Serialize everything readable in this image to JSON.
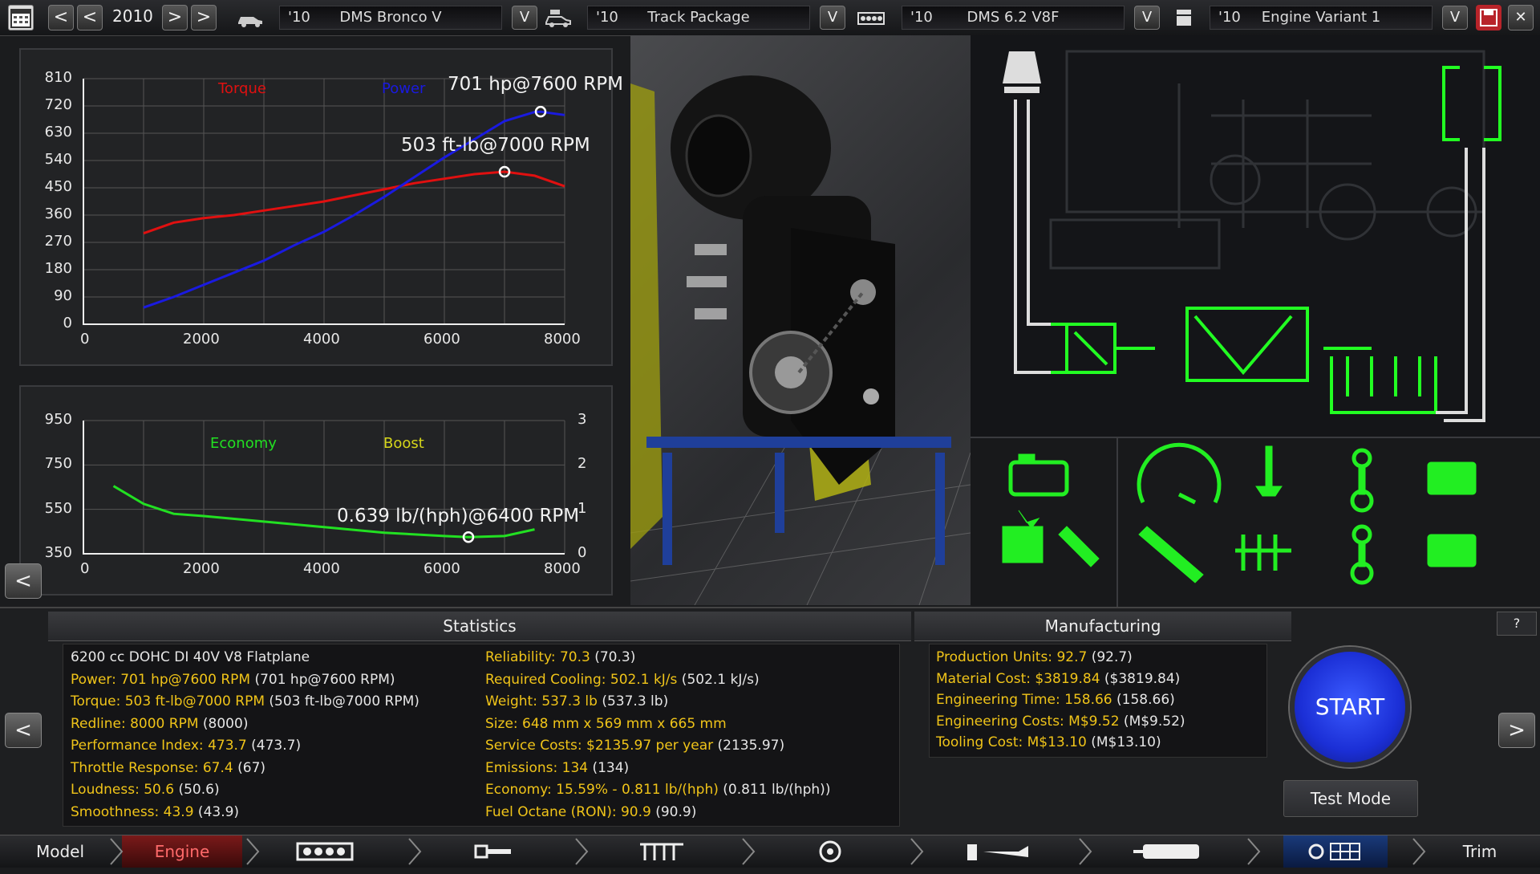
{
  "topbar": {
    "year": "2010",
    "model": {
      "year": "'10",
      "name": "DMS Bronco V"
    },
    "trim": {
      "year": "'10",
      "name": "Track Package"
    },
    "engine_family": {
      "year": "'10",
      "name": "DMS 6.2 V8F"
    },
    "engine_variant": {
      "year": "'10",
      "name": "Engine Variant 1"
    },
    "prev_label": "<",
    "next_label": ">",
    "dropdown_label": "V",
    "close_label": "✕"
  },
  "power_chart": {
    "legend_torque": "Torque",
    "legend_power": "Power",
    "power_peak_label": "701 hp@7600 RPM",
    "torque_peak_label": "503 ft-lb@7000 RPM",
    "y_ticks": [
      "810",
      "720",
      "630",
      "540",
      "450",
      "360",
      "270",
      "180",
      "90",
      "0"
    ],
    "x_ticks": [
      "0",
      "2000",
      "4000",
      "6000",
      "8000"
    ]
  },
  "economy_chart": {
    "legend_economy": "Economy",
    "legend_boost": "Boost",
    "economy_peak_label": "0.639 lb/(hph)@6400 RPM",
    "y_ticks": [
      "950",
      "750",
      "550",
      "350"
    ],
    "y2_ticks": [
      "3",
      "2",
      "1",
      "0"
    ],
    "x_ticks": [
      "0",
      "2000",
      "4000",
      "6000",
      "8000"
    ]
  },
  "chart_data": [
    {
      "type": "line",
      "xlim": [
        0,
        8000
      ],
      "ylim": [
        0,
        810
      ],
      "series": [
        {
          "name": "Torque",
          "color": "#e01010",
          "x": [
            1000,
            1500,
            2000,
            2500,
            3000,
            3500,
            4000,
            4500,
            5000,
            5500,
            6000,
            6500,
            7000,
            7500,
            8000
          ],
          "values": [
            300,
            335,
            350,
            360,
            375,
            390,
            405,
            425,
            445,
            465,
            480,
            495,
            503,
            490,
            455
          ]
        },
        {
          "name": "Power",
          "color": "#1a1ae0",
          "x": [
            1000,
            1500,
            2000,
            2500,
            3000,
            3500,
            4000,
            4500,
            5000,
            5500,
            6000,
            6500,
            7000,
            7500,
            7600,
            8000
          ],
          "values": [
            55,
            90,
            130,
            170,
            210,
            260,
            305,
            360,
            420,
            485,
            550,
            610,
            670,
            700,
            701,
            690
          ]
        }
      ],
      "markers": [
        {
          "series": "Power",
          "x": 7600,
          "y": 701
        },
        {
          "series": "Torque",
          "x": 7000,
          "y": 503
        }
      ]
    },
    {
      "type": "line",
      "xlim": [
        0,
        8000
      ],
      "ylim": [
        350,
        950
      ],
      "series": [
        {
          "name": "Economy",
          "color": "#22e022",
          "x": [
            500,
            1000,
            1500,
            2000,
            3000,
            4000,
            5000,
            6000,
            6400,
            7000,
            7500
          ],
          "values": [
            655,
            575,
            530,
            520,
            495,
            470,
            445,
            430,
            425,
            430,
            460
          ]
        }
      ],
      "markers": [
        {
          "series": "Economy",
          "x": 6400,
          "y": 425
        }
      ]
    }
  ],
  "statistics": {
    "header": "Statistics",
    "left": [
      {
        "main": "6200 cc DOHC DI 40V V8 Flatplane",
        "paren": "",
        "white": true
      },
      {
        "main": "Power: 701 hp@7600 RPM",
        "paren": "(701 hp@7600 RPM)"
      },
      {
        "main": "Torque: 503 ft-lb@7000 RPM",
        "paren": "(503 ft-lb@7000 RPM)"
      },
      {
        "main": "Redline: 8000 RPM",
        "paren": "(8000)"
      },
      {
        "main": "Performance Index: 473.7",
        "paren": "(473.7)"
      },
      {
        "main": "Throttle Response: 67.4",
        "paren": "(67)"
      },
      {
        "main": "Loudness: 50.6",
        "paren": "(50.6)"
      },
      {
        "main": "Smoothness: 43.9",
        "paren": "(43.9)"
      }
    ],
    "right": [
      {
        "main": "Reliability: 70.3",
        "paren": "(70.3)"
      },
      {
        "main": "Required Cooling: 502.1 kJ/s",
        "paren": "(502.1 kJ/s)"
      },
      {
        "main": "Weight: 537.3 lb",
        "paren": "(537.3 lb)"
      },
      {
        "main": "Size: 648 mm x 569 mm x 665 mm",
        "paren": ""
      },
      {
        "main": "Service Costs: $2135.97 per year",
        "paren": "(2135.97)"
      },
      {
        "main": "Emissions: 134",
        "paren": "(134)"
      },
      {
        "main": "Economy: 15.59% - 0.811 lb/(hph)",
        "paren": "(0.811 lb/(hph))"
      },
      {
        "main": "Fuel Octane (RON): 90.9",
        "paren": "(90.9)"
      }
    ]
  },
  "manufacturing": {
    "header": "Manufacturing",
    "rows": [
      {
        "main": "Production Units: 92.7",
        "paren": "(92.7)"
      },
      {
        "main": "Material Cost: $3819.84",
        "paren": "($3819.84)"
      },
      {
        "main": "Engineering Time: 158.66",
        "paren": "(158.66)"
      },
      {
        "main": "Engineering Costs: M$9.52",
        "paren": "(M$9.52)"
      },
      {
        "main": "Tooling Cost: M$13.10",
        "paren": "(M$13.10)"
      }
    ]
  },
  "actions": {
    "start_label": "START",
    "test_mode_label": "Test Mode",
    "help_label": "?"
  },
  "bottom_nav": {
    "model_label": "Model",
    "engine_label": "Engine",
    "trim_label": "Trim"
  }
}
